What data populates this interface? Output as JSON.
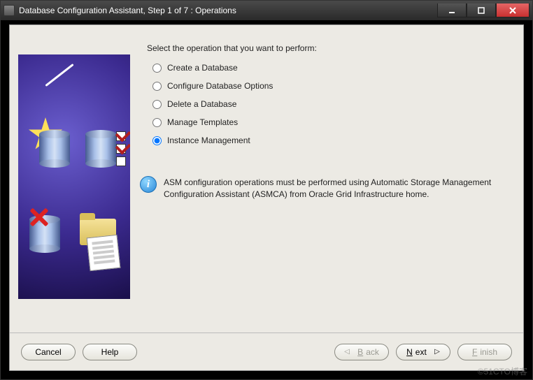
{
  "window": {
    "title": "Database Configuration Assistant, Step 1 of 7 : Operations"
  },
  "prompt": "Select the operation that you want to perform:",
  "options": [
    {
      "label": "Create a Database",
      "selected": false
    },
    {
      "label": "Configure Database Options",
      "selected": false
    },
    {
      "label": "Delete a Database",
      "selected": false
    },
    {
      "label": "Manage Templates",
      "selected": false
    },
    {
      "label": "Instance Management",
      "selected": true
    }
  ],
  "info": {
    "text": "ASM configuration operations must be performed using Automatic Storage Management Configuration Assistant (ASMCA) from Oracle Grid Infrastructure home."
  },
  "buttons": {
    "cancel": "Cancel",
    "help": "Help",
    "back_prefix": "B",
    "back_rest": "ack",
    "next_prefix": "N",
    "next_rest": "ext",
    "finish_prefix": "F",
    "finish_rest": "inish"
  },
  "watermark": "©51CTO博客"
}
